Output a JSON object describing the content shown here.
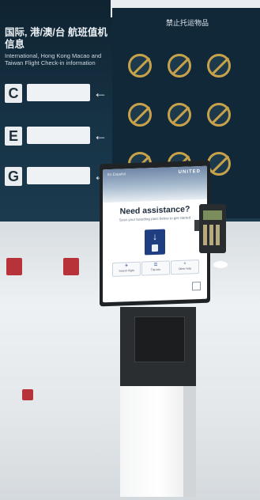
{
  "board": {
    "title": "国际, 港/澳/台 航班值机信息",
    "subtitle": "International, Hong Kong Macao and Taiwan Flight Check-in information",
    "prohibited_title": "禁止托运物品",
    "gates": [
      {
        "letter": "C",
        "arrow": "←"
      },
      {
        "letter": "E",
        "arrow": "←"
      },
      {
        "letter": "G",
        "arrow": "←"
      }
    ]
  },
  "kiosk": {
    "brand": "UNITED",
    "language": "En Español",
    "headline": "Need assistance?",
    "subline": "Scan your boarding pass below to get started",
    "scan_arrow": "↓",
    "options": [
      {
        "icon": "✈",
        "label": "Search flight"
      },
      {
        "icon": "☰",
        "label": "Trip info"
      },
      {
        "icon": "+",
        "label": "Other help"
      }
    ]
  },
  "colors": {
    "board": "#173447",
    "kiosk_accent": "#1f3e82",
    "stand": "#2b2e31",
    "icon_ring": "#c8a24a"
  }
}
